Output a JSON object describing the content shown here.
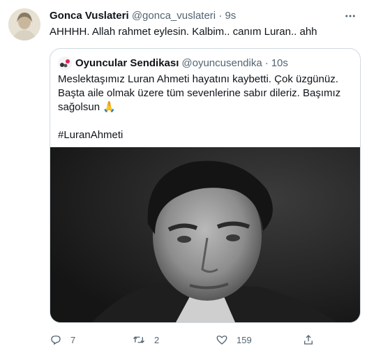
{
  "tweet": {
    "author_name": "Gonca Vuslateri",
    "author_handle": "@gonca_vuslateri",
    "separator": "·",
    "time": "9s",
    "text": "AHHHH. Allah rahmet eylesin. Kalbim.. canım Luran.. ahh"
  },
  "quote": {
    "author_name": "Oyuncular Sendikası",
    "author_handle": "@oyuncusendika",
    "separator": "·",
    "time": "10s",
    "line1": "Meslektaşımız Luran Ahmeti hayatını kaybetti. Çok üzgünüz.",
    "line2": "Başta aile olmak üzere tüm sevenlerine sabır dileriz. Başımız",
    "line3": "sağolsun 🙏",
    "hashtag": "#LuranAhmeti"
  },
  "actions": {
    "reply_count": "7",
    "retweet_count": "2",
    "like_count": "159"
  },
  "icons": [
    "more-icon",
    "reply-icon",
    "retweet-icon",
    "like-icon",
    "share-icon"
  ],
  "colors": {
    "text": "#0f1419",
    "secondary": "#536471",
    "border": "#cfd9de"
  }
}
